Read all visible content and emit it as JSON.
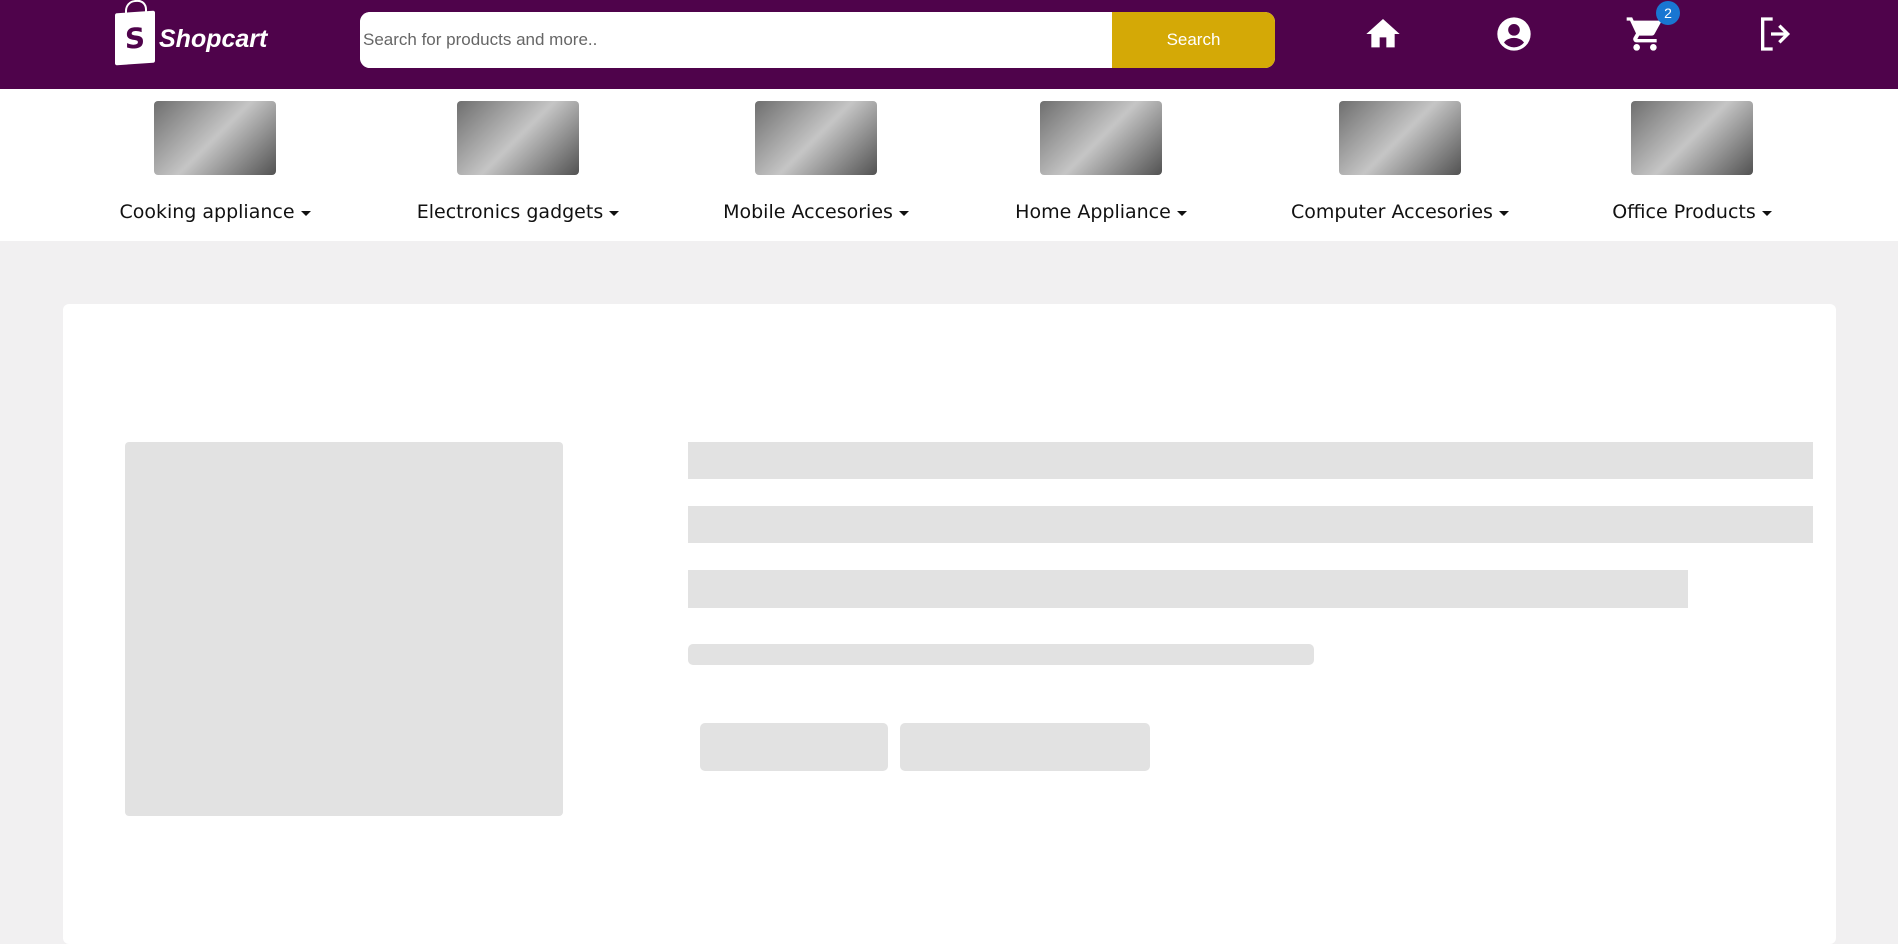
{
  "header": {
    "logo_text": "Shopcart",
    "logo_letter": "S",
    "search_placeholder": "Search for products and more..",
    "search_button": "Search",
    "cart_count": "2",
    "icons": [
      "home-icon",
      "account-icon",
      "cart-icon",
      "logout-icon"
    ]
  },
  "categories": [
    {
      "label": "Cooking appliance"
    },
    {
      "label": "Electronics gadgets"
    },
    {
      "label": "Mobile Accesories"
    },
    {
      "label": "Home Appliance"
    },
    {
      "label": "Computer Accesories"
    },
    {
      "label": "Office Products"
    }
  ],
  "colors": {
    "header": "#4f034b",
    "search_button": "#d4a906",
    "badge": "#1976d2",
    "skeleton": "#e2e2e2"
  }
}
